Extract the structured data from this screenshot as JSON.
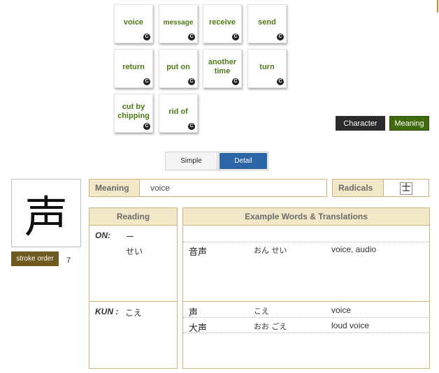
{
  "cards": [
    {
      "label": "voice",
      "badge": "C"
    },
    {
      "label": "message",
      "badge": "C"
    },
    {
      "label": "receive",
      "badge": "C"
    },
    {
      "label": "send",
      "badge": "C"
    },
    {
      "label": "return",
      "badge": "C"
    },
    {
      "label": "put on",
      "badge": "C"
    },
    {
      "label": "another time",
      "badge": "C"
    },
    {
      "label": "turn",
      "badge": "C"
    },
    {
      "label": "cut by chipping",
      "badge": "C"
    },
    {
      "label": "rid of",
      "badge": "C"
    }
  ],
  "mode_buttons": {
    "character": "Character",
    "meaning": "Meaning"
  },
  "view_toggle": {
    "simple": "Simple",
    "detail": "Detail",
    "active": "Detail"
  },
  "kanji": {
    "character": "声",
    "stroke_order_label": "stroke order",
    "stroke_count": "7"
  },
  "meaning": {
    "label": "Meaning",
    "value": "voice"
  },
  "radicals": {
    "label": "Radicals",
    "value": "士"
  },
  "reading": {
    "header": "Reading",
    "on_label": "ON:",
    "on_readings": [
      "ー",
      "せい"
    ],
    "kun_label": "KUN :",
    "kun_readings": [
      "こえ"
    ]
  },
  "examples": {
    "header": "Example Words & Translations",
    "on_words": [
      {
        "word": "音声",
        "reading": "おん せい",
        "translation": "voice, audio"
      }
    ],
    "kun_words": [
      {
        "word": "声",
        "reading": "こえ",
        "translation": "voice"
      },
      {
        "word": "大声",
        "reading": "おお ごえ",
        "translation": "loud voice"
      }
    ]
  },
  "colors": {
    "accent_green": "#4e7a15",
    "active_blue": "#2c65a6",
    "gold_header": "#f2e7c6",
    "stroke_brown": "#6e5a1f"
  }
}
